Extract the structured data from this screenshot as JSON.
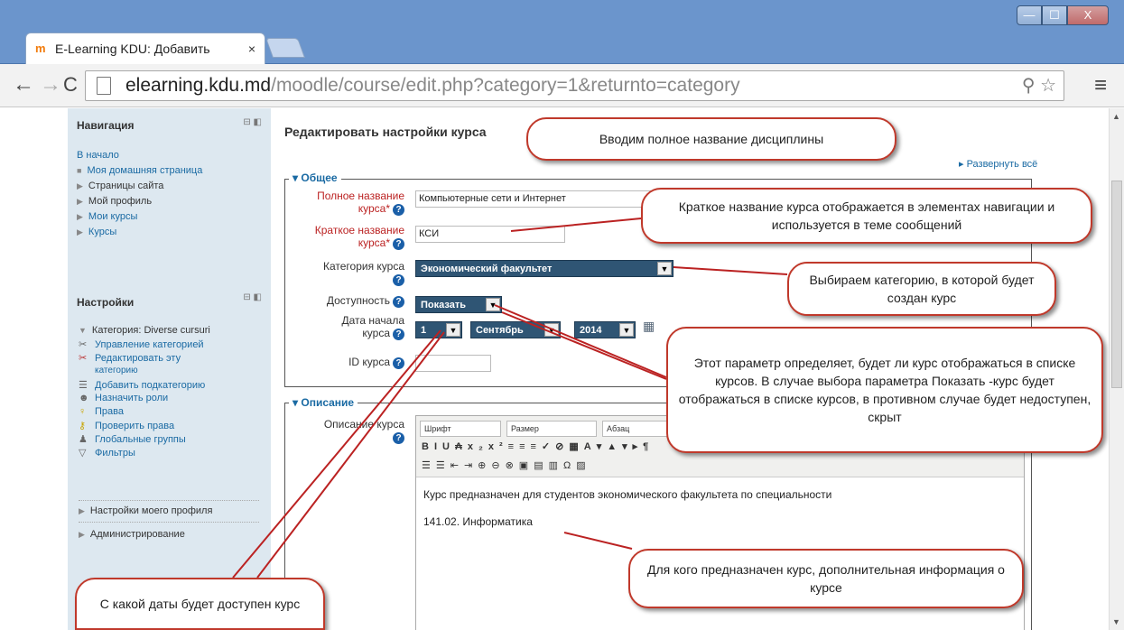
{
  "browser": {
    "tab_title": "E-Learning KDU: Добавить",
    "tab_close": "×",
    "url_host": "elearning.kdu.md",
    "url_path": "/moodle/course/edit.php?category=1&returnto=category",
    "window_min": "—",
    "window_max": "☐",
    "window_close": "X"
  },
  "sidebar": {
    "nav_title": "Навигация",
    "nav_items": [
      "В начало",
      "Моя домашняя страница",
      "Страницы сайта",
      "Мой профиль",
      "Мои курсы",
      "Курсы"
    ],
    "settings_title": "Настройки",
    "settings_category": "Категория: Diverse cursuri",
    "settings_items": [
      "Управление категорией",
      "Редактировать эту",
      "категорию",
      "Добавить подкатегорию",
      "Назначить роли",
      "Права",
      "Проверить права",
      "Глобальные группы",
      "Фильтры"
    ],
    "profile_settings": "Настройки моего профиля",
    "administration": "Администрирование"
  },
  "main": {
    "page_title": "Редактировать настройки курса",
    "expand_all": "▸ Развернуть всё",
    "general_legend": "▾ Общее",
    "fullname_label_1": "Полное название",
    "fullname_label_2": "курса*",
    "fullname_value": "Компьютерные сети и Интернет",
    "shortname_label_1": "Краткое название",
    "shortname_label_2": "курса*",
    "shortname_value": "КСИ",
    "category_label": "Категория курса",
    "category_value": "Экономический факультет",
    "visibility_label": "Доступность",
    "visibility_value": "Показать",
    "startdate_label_1": "Дата начала",
    "startdate_label_2": "курса",
    "day_value": "1",
    "month_value": "Сентябрь",
    "year_value": "2014",
    "idnumber_label": "ID курса",
    "description_legend": "▾ Описание",
    "description_label": "Описание курса",
    "editor": {
      "font_select": "Шрифт",
      "size_select": "Размер",
      "paragraph_select": "Абзац",
      "text_line_1": "Курс предназначен для студентов экономического факультета по специальности",
      "text_line_2": "141.02. Информатика"
    }
  },
  "callouts": {
    "fullname": "Вводим полное название дисциплины",
    "shortname": "Краткое название курса отображается в элементах навигации и используется в теме сообщений",
    "category": "Выбираем категорию, в которой будет создан курс",
    "visibility": "Этот параметр определяет, будет ли курс отображаться в списке курсов. В случае выбора параметра Показать -курс будет отображаться в списке курсов, в противном случае будет недоступен, скрыт",
    "description": "Для кого предназначен курс, дополнительная информация о курсе",
    "startdate": "С какой даты будет доступен курс"
  }
}
